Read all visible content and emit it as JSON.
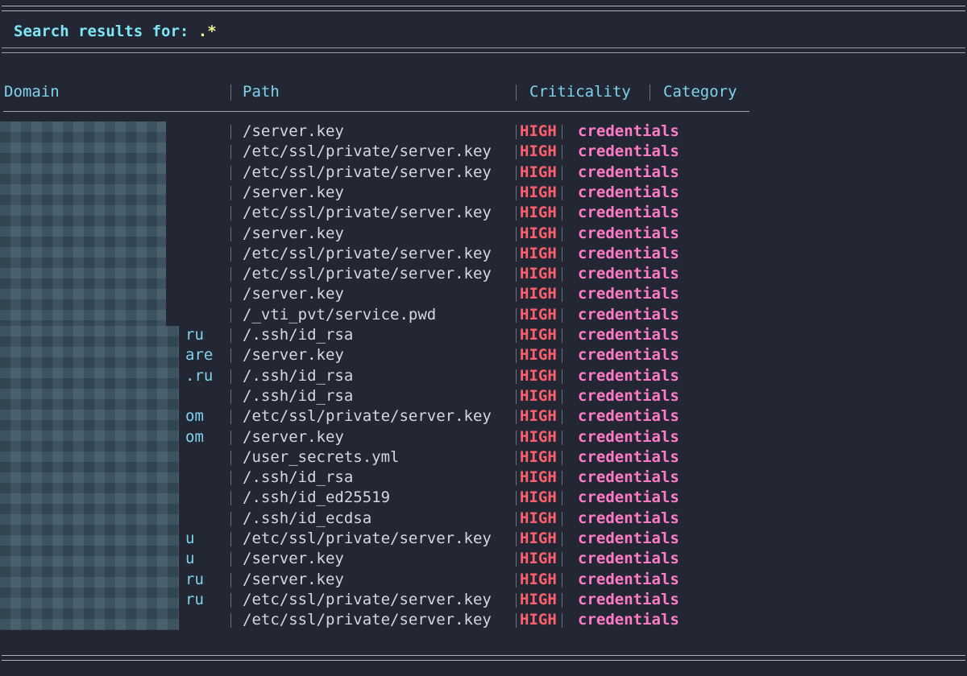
{
  "title": {
    "prefix": "Search results for: ",
    "pattern": ".*"
  },
  "columns": {
    "domain": "Domain",
    "path": "Path",
    "criticality": "Criticality",
    "category": "Category"
  },
  "rows": [
    {
      "domain": "",
      "path": "/server.key",
      "criticality": "HIGH",
      "category": "credentials"
    },
    {
      "domain": "",
      "path": "/etc/ssl/private/server.key",
      "criticality": "HIGH",
      "category": "credentials"
    },
    {
      "domain": "",
      "path": "/etc/ssl/private/server.key",
      "criticality": "HIGH",
      "category": "credentials"
    },
    {
      "domain": "",
      "path": "/server.key",
      "criticality": "HIGH",
      "category": "credentials"
    },
    {
      "domain": "",
      "path": "/etc/ssl/private/server.key",
      "criticality": "HIGH",
      "category": "credentials"
    },
    {
      "domain": "",
      "path": "/server.key",
      "criticality": "HIGH",
      "category": "credentials"
    },
    {
      "domain": "",
      "path": "/etc/ssl/private/server.key",
      "criticality": "HIGH",
      "category": "credentials"
    },
    {
      "domain": "",
      "path": "/etc/ssl/private/server.key",
      "criticality": "HIGH",
      "category": "credentials"
    },
    {
      "domain": "",
      "path": "/server.key",
      "criticality": "HIGH",
      "category": "credentials"
    },
    {
      "domain": "",
      "path": "/_vti_pvt/service.pwd",
      "criticality": "HIGH",
      "category": "credentials"
    },
    {
      "domain": "ru",
      "path": "/.ssh/id_rsa",
      "criticality": "HIGH",
      "category": "credentials"
    },
    {
      "domain": "are",
      "path": "/server.key",
      "criticality": "HIGH",
      "category": "credentials"
    },
    {
      "domain": ".ru",
      "path": "/.ssh/id_rsa",
      "criticality": "HIGH",
      "category": "credentials"
    },
    {
      "domain": "",
      "path": "/.ssh/id_rsa",
      "criticality": "HIGH",
      "category": "credentials"
    },
    {
      "domain": "om",
      "path": "/etc/ssl/private/server.key",
      "criticality": "HIGH",
      "category": "credentials"
    },
    {
      "domain": "om",
      "path": "/server.key",
      "criticality": "HIGH",
      "category": "credentials"
    },
    {
      "domain": "",
      "path": "/user_secrets.yml",
      "criticality": "HIGH",
      "category": "credentials"
    },
    {
      "domain": "",
      "path": "/.ssh/id_rsa",
      "criticality": "HIGH",
      "category": "credentials"
    },
    {
      "domain": "",
      "path": "/.ssh/id_ed25519",
      "criticality": "HIGH",
      "category": "credentials"
    },
    {
      "domain": "",
      "path": "/.ssh/id_ecdsa",
      "criticality": "HIGH",
      "category": "credentials"
    },
    {
      "domain": "u",
      "path": "/etc/ssl/private/server.key",
      "criticality": "HIGH",
      "category": "credentials"
    },
    {
      "domain": "u",
      "path": "/server.key",
      "criticality": "HIGH",
      "category": "credentials"
    },
    {
      "domain": "ru",
      "path": "/server.key",
      "criticality": "HIGH",
      "category": "credentials"
    },
    {
      "domain": "ru",
      "path": "/etc/ssl/private/server.key",
      "criticality": "HIGH",
      "category": "credentials"
    },
    {
      "domain": "",
      "path": "/etc/ssl/private/server.key",
      "criticality": "HIGH",
      "category": "credentials"
    }
  ],
  "colors": {
    "background": "#232734",
    "title": "#7fe6f6",
    "pattern": "#f1fa8c",
    "header": "#7fd3ec",
    "criticality_high": "#ff5f6d",
    "category": "#ff7bc5",
    "path": "#d5d8df"
  }
}
